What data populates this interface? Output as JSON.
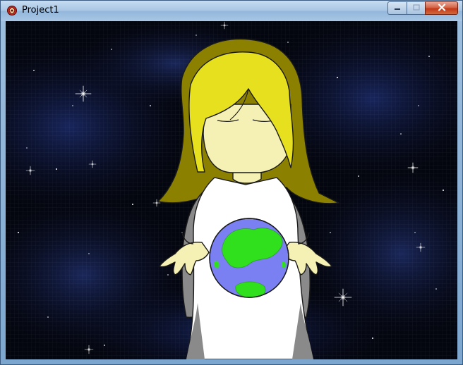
{
  "window": {
    "title": "Project1",
    "app_icon": "rpg-maker-icon",
    "controls": {
      "minimize_icon": "minimize-icon",
      "maximize_icon": "maximize-icon",
      "close_icon": "close-icon"
    }
  },
  "scene": {
    "background": "starry-night-sky",
    "character": "goddess-holding-globe",
    "object": "earth-globe",
    "colors": {
      "sky": "#04060f",
      "hair": "#e6e01e",
      "hair_shadow": "#8b8000",
      "skin": "#f5f0b4",
      "robe": "#ffffff",
      "robe_shadow": "#8a8a8a",
      "ocean": "#7a80f2",
      "land": "#30e01c"
    }
  }
}
